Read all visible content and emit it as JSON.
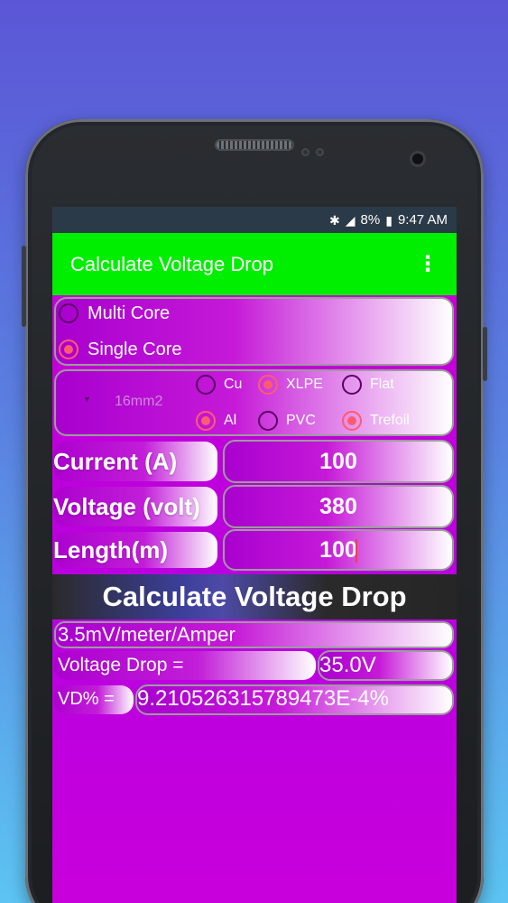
{
  "status_bar": {
    "bluetooth_icon": "bluetooth-icon",
    "signal_icon": "signal-icon",
    "battery_percent": "8%",
    "battery_icon": "battery-icon",
    "time": "9:47 AM"
  },
  "app_bar": {
    "title": "Calculate Voltage Drop",
    "menu_icon": "more-vert-icon"
  },
  "core_type": {
    "options": [
      "Multi Core",
      "Single Core"
    ],
    "selected": "Single Core"
  },
  "cable": {
    "size_selected": "16mm2",
    "material": {
      "options": [
        "Cu",
        "Al"
      ],
      "selected": "Al"
    },
    "insulation": {
      "options": [
        "XLPE",
        "PVC"
      ],
      "selected": "XLPE"
    },
    "arrangement": {
      "options": [
        "Flat",
        "Trefoil"
      ],
      "selected": "Trefoil"
    }
  },
  "inputs": {
    "current": {
      "label": "Current (A)",
      "value": "100"
    },
    "voltage": {
      "label": "Voltage (volt)",
      "value": "380"
    },
    "length": {
      "label": "Length(m)",
      "value": "100"
    }
  },
  "calculate_button": "Calculate Voltage Drop",
  "results": {
    "mv_per_meter": "3.5mV/meter/Amper",
    "voltage_drop_label": "Voltage Drop  =",
    "voltage_drop_value": "35.0V",
    "vd_percent_label": "VD% =",
    "vd_percent_value": "9.210526315789473E-4%"
  },
  "colors": {
    "app_bar": "#00ee00",
    "status_bar": "#2b3a48",
    "content_bg": "#c600d6",
    "radio_selected": "#ff5b6e"
  }
}
